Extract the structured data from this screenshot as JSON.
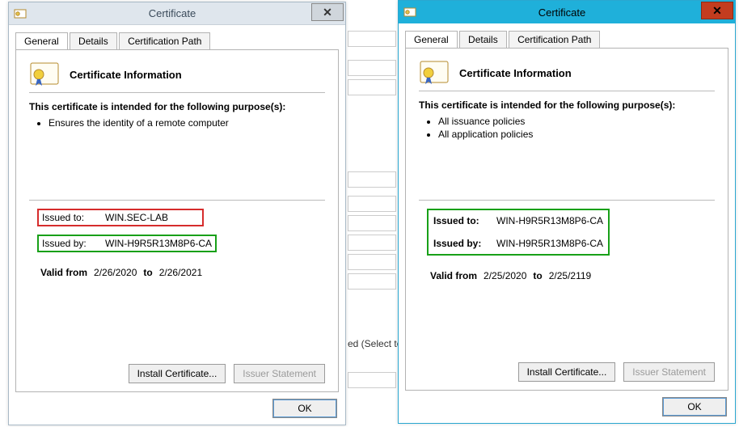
{
  "background": {
    "snippet1": "ed (Select to c"
  },
  "dialogs": {
    "left": {
      "title": "Certificate",
      "tabs": {
        "general": "General",
        "details": "Details",
        "path": "Certification Path"
      },
      "info_heading": "Certificate Information",
      "purpose_intro": "This certificate is intended for the following purpose(s):",
      "purposes": [
        "Ensures the identity of a remote computer"
      ],
      "issued_to_label": "Issued to:",
      "issued_to_value": "WIN.SEC-LAB",
      "issued_by_label": "Issued by:",
      "issued_by_value": "WIN-H9R5R13M8P6-CA",
      "valid_from_label": "Valid from",
      "valid_from_value": "2/26/2020",
      "valid_to_label": "to",
      "valid_to_value": "2/26/2021",
      "install_btn": "Install Certificate...",
      "issuer_btn": "Issuer Statement",
      "ok_btn": "OK"
    },
    "right": {
      "title": "Certificate",
      "tabs": {
        "general": "General",
        "details": "Details",
        "path": "Certification Path"
      },
      "info_heading": "Certificate Information",
      "purpose_intro": "This certificate is intended for the following purpose(s):",
      "purposes": [
        "All issuance policies",
        "All application policies"
      ],
      "issued_to_label": "Issued to:",
      "issued_to_value": "WIN-H9R5R13M8P6-CA",
      "issued_by_label": "Issued by:",
      "issued_by_value": "WIN-H9R5R13M8P6-CA",
      "valid_from_label": "Valid from",
      "valid_from_value": "2/25/2020",
      "valid_to_label": "to",
      "valid_to_value": "2/25/2119",
      "install_btn": "Install Certificate...",
      "issuer_btn": "Issuer Statement",
      "ok_btn": "OK"
    }
  }
}
